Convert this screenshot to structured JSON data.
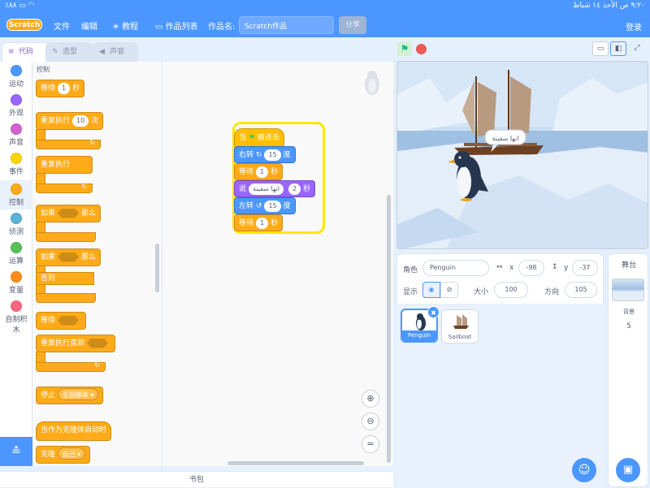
{
  "status_bar": {
    "time": "٩:٢٠ ص",
    "date": "الأحد ١٤ شباط",
    "battery": "٪٨٨",
    "wifi": "wifi-icon"
  },
  "menu": {
    "logo": "Scratch",
    "file": "文件",
    "edit": "编辑",
    "tutorials": "教程",
    "my_stuff": "作品列表",
    "title_label": "作品名:",
    "title_value": "Scratch作品",
    "share": "分享",
    "login": "登录"
  },
  "tabs": {
    "code": "代码",
    "costumes": "造型",
    "sounds": "声音"
  },
  "categories": [
    {
      "label": "运动",
      "color": "#4c97ff"
    },
    {
      "label": "外观",
      "color": "#9966ff"
    },
    {
      "label": "声音",
      "color": "#cf63cf"
    },
    {
      "label": "事件",
      "color": "#ffd500"
    },
    {
      "label": "控制",
      "color": "#ffab19"
    },
    {
      "label": "侦测",
      "color": "#5cb1d6"
    },
    {
      "label": "运算",
      "color": "#59c059"
    },
    {
      "label": "变量",
      "color": "#ff8c1a"
    },
    {
      "label": "自制积木",
      "color": "#ff6680"
    }
  ],
  "palette": {
    "title": "控制",
    "wait": "等待",
    "wait_val": "1",
    "seconds": "秒",
    "repeat": "重复执行",
    "repeat_val": "10",
    "times": "次",
    "forever": "重复执行",
    "if": "如果",
    "then": "那么",
    "else": "否则",
    "wait_until": "等待",
    "repeat_until": "重复执行直到",
    "stop": "停止",
    "stop_val": "全部脚本",
    "clone_start": "当作为克隆体启动时",
    "clone": "克隆",
    "clone_val": "自己"
  },
  "script": {
    "hat": "当",
    "hat_tail": "被点击",
    "turn_right": "右转",
    "turn_right_val": "15",
    "deg": "度",
    "wait1": "等待",
    "wait1_val": "1",
    "sec": "秒",
    "say": "说",
    "say_text": "انها سفينة",
    "say_secs": "2",
    "say_sec": "秒",
    "turn_left": "左转",
    "turn_left_val": "15",
    "deg2": "度",
    "wait2": "等待",
    "wait2_val": "1",
    "sec2": "秒"
  },
  "backpack": "书包",
  "stage": {
    "speech": "انها سفينة"
  },
  "sprite_info": {
    "sprite_label": "角色",
    "sprite_name": "Penguin",
    "x_label": "x",
    "x_val": "-98",
    "y_label": "y",
    "y_val": "-37",
    "show_label": "显示",
    "size_label": "大小",
    "size_val": "100",
    "direction_label": "方向",
    "direction_val": "105"
  },
  "sprites": [
    {
      "name": "Penguin",
      "selected": true
    },
    {
      "name": "Sailboat",
      "selected": false
    }
  ],
  "stage_pane": {
    "title": "舞台",
    "backdrops_label": "背景",
    "backdrops_count": "5"
  }
}
